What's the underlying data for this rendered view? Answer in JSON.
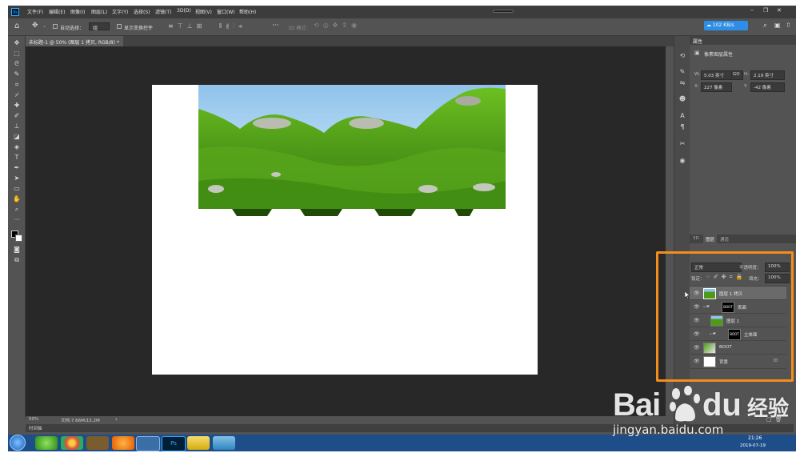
{
  "app": {
    "logo": "Ps",
    "brand_color": "#31a8ff"
  },
  "menu": [
    "文件(F)",
    "编辑(E)",
    "图像(I)",
    "图层(L)",
    "文字(Y)",
    "选择(S)",
    "滤镜(T)",
    "3D(D)",
    "视图(V)",
    "窗口(W)",
    "帮助(H)"
  ],
  "window_controls": {
    "minimize": "–",
    "restore": "❐",
    "close": "✕"
  },
  "options": {
    "auto_select_label": "自动选择：",
    "auto_select_value": "组",
    "show_transform_label": "显示变换控件",
    "mode_label": "3D 模式：",
    "network_speed": "102 KB/s"
  },
  "document_tab": "未标题-1 @ 50% (图层 1 拷贝, RGB/8) *",
  "status": {
    "zoom": "50%",
    "doc_size": "文档:7.66M/15.2M"
  },
  "timeline_label": "时间轴",
  "properties": {
    "tab": "属性",
    "subtitle": "像素图层属性",
    "w_label": "W:",
    "w_value": "5.03 英寸",
    "link_label": "GO",
    "h_label": "H:",
    "h_value": "2.19 英寸",
    "x_label": "X:",
    "x_value": "227 像素",
    "y_label": "Y:",
    "y_value": "-42 像素"
  },
  "layers_panel": {
    "tabs": [
      "3D",
      "图层",
      "通道"
    ],
    "active_tab": "图层",
    "blend_mode": "正常",
    "opacity_label": "不透明度：",
    "opacity_value": "100%",
    "lock_label": "锁定：",
    "fill_label": "填充：",
    "fill_value": "100%",
    "layers": [
      {
        "name": "图层 1 拷贝",
        "selected": true
      },
      {
        "name": "表面",
        "group": true,
        "mask_text": "BOOT"
      },
      {
        "name": "图层 1"
      },
      {
        "name": "立体面",
        "group": true,
        "mask_text": "BOOT"
      },
      {
        "name": "BOOT"
      },
      {
        "name": "背景",
        "locked": true
      }
    ]
  },
  "taskbar": {
    "time": "21:26",
    "date": "2019-07-19"
  },
  "watermark": {
    "brand": "Bai",
    "brand2": "du",
    "cn": "经验",
    "url": "jingyan.baidu.com"
  },
  "colors": {
    "highlight": "#f28e1c",
    "grass": "#4f9a18",
    "sky": "#a9d4ee",
    "taskbar": "#1e4e8a"
  }
}
